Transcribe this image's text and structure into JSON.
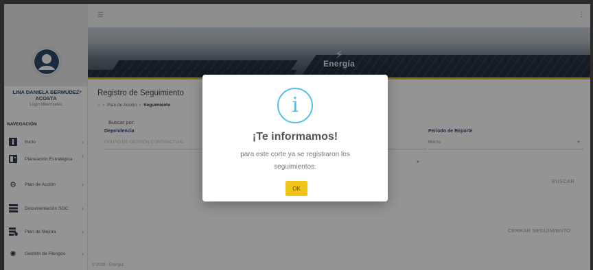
{
  "user": {
    "name": "LINA DANIELA BERMUDEZ ACOSTA",
    "login": "Login ldbermudez"
  },
  "sidebar": {
    "nav_title": "NAVEGACIÓN",
    "items": [
      {
        "label": "Inicio",
        "icon": "home-icon"
      },
      {
        "label": "Planeación Estratégica",
        "icon": "strategy-icon"
      },
      {
        "label": "Plan de Acción",
        "icon": "gear-icon"
      },
      {
        "label": "Documentación SGC",
        "icon": "documents-icon"
      },
      {
        "label": "Plan de Mejora",
        "icon": "improvement-icon"
      },
      {
        "label": "Gestión de Riesgos",
        "icon": "risk-icon"
      }
    ]
  },
  "banner": {
    "title": "Energía"
  },
  "page": {
    "title": "Registro de Seguimiento",
    "breadcrumb": {
      "level1": "Plan de Acción",
      "current": "Seguimiento"
    },
    "search_label": "Buscar por:",
    "dependencia_label": "Dependencia",
    "dependencia_value": "GRUPO DE GESTIÓN CONTRACTUAL",
    "periodo_label": "Periodo de Reporte",
    "periodo_value": "Marzo",
    "buscar_button": "BUSCAR",
    "cerrar_button": "CERRAR SEGUIMIENTO",
    "footer": "© 2026 - Energía"
  },
  "modal": {
    "icon": "info-icon",
    "title": "¡Te informamos!",
    "message": "para este corte ya se registraron los seguimientos.",
    "ok_label": "OK",
    "accent_color": "#4fc0e8",
    "button_color": "#f0c419"
  }
}
